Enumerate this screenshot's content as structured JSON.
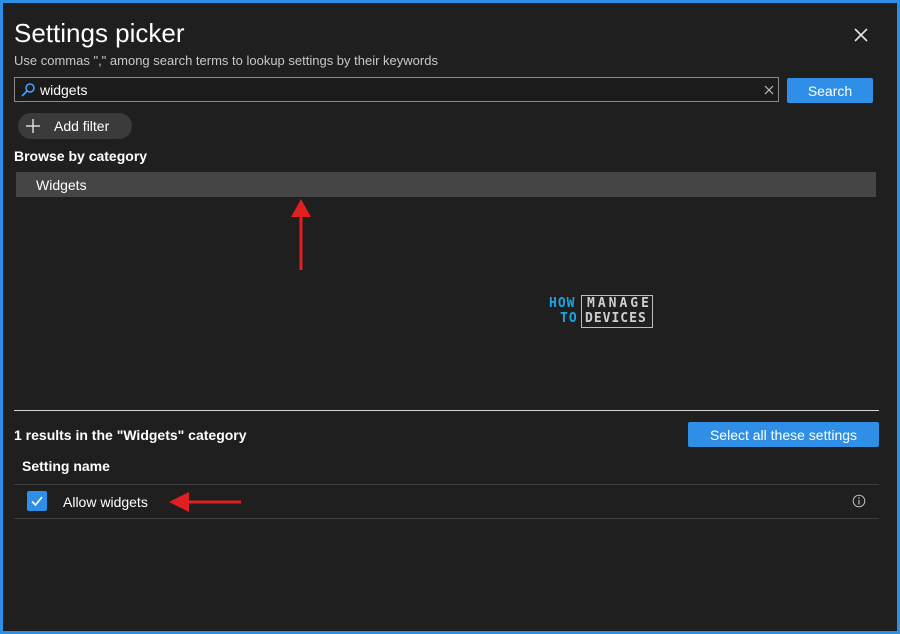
{
  "panel": {
    "title": "Settings picker",
    "subtitle": "Use commas \",\" among search terms to lookup settings by their keywords",
    "close_icon": "close-icon"
  },
  "search": {
    "value": "widgets",
    "icon": "search-icon",
    "clear_icon": "clear-icon",
    "button_label": "Search"
  },
  "filter": {
    "add_label": "Add filter",
    "icon": "plus-icon"
  },
  "browse": {
    "heading": "Browse by category",
    "categories": [
      {
        "label": "Widgets",
        "selected": true
      }
    ]
  },
  "watermark": {
    "how": "HOW",
    "to": "TO",
    "manage": "MANAGE",
    "devices": "DEVICES"
  },
  "results": {
    "summary": "1 results in the \"Widgets\" category",
    "select_all_label": "Select all these settings",
    "column_header": "Setting name",
    "rows": [
      {
        "label": "Allow widgets",
        "checked": true,
        "info_icon": "info-icon"
      }
    ]
  },
  "colors": {
    "accent": "#2f8fe6",
    "frame_border": "#2d8fe3",
    "background": "#1f1f1f",
    "annotation_arrow": "#e02020"
  }
}
